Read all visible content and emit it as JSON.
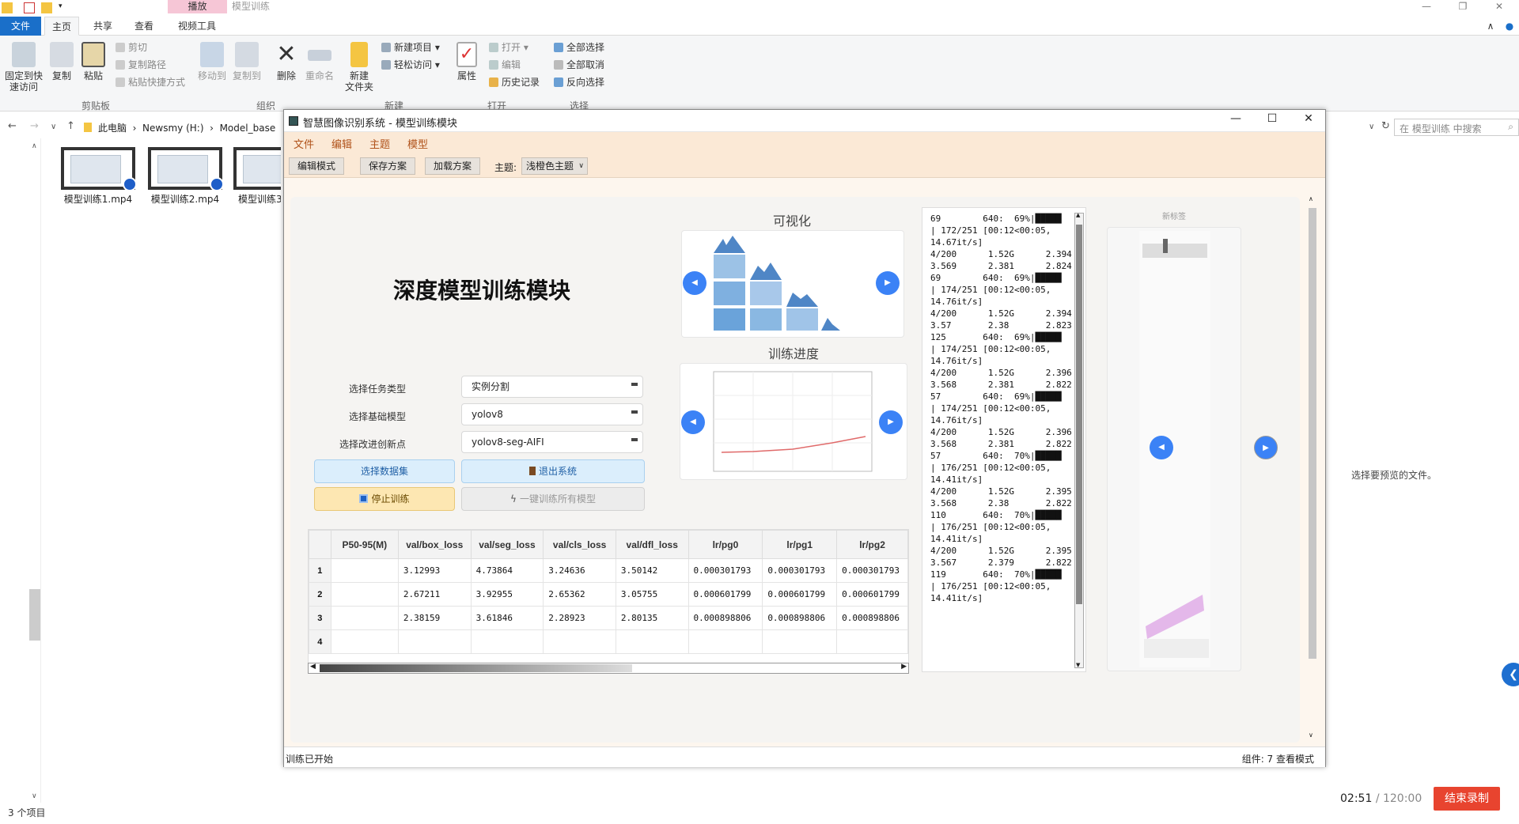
{
  "explorer": {
    "context_tab": "播放",
    "window_title": "模型训练",
    "tabs": [
      "文件",
      "主页",
      "共享",
      "查看",
      "视频工具"
    ],
    "ribbon": {
      "clipboard": {
        "pin": "固定到快\n速访问",
        "copy": "复制",
        "paste": "粘贴",
        "cut": "剪切",
        "copy_path": "复制路径",
        "paste_shortcut": "粘贴快捷方式",
        "group": "剪贴板"
      },
      "organize": {
        "move_to": "移动到",
        "copy_to": "复制到",
        "delete": "删除",
        "rename": "重命名",
        "group": "组织"
      },
      "new": {
        "new_folder": "新建\n文件夹",
        "new_item": "新建项目 ▾",
        "easy_access": "轻松访问 ▾",
        "group": "新建"
      },
      "open": {
        "properties": "属性",
        "open": "打开 ▾",
        "edit": "编辑",
        "history": "历史记录",
        "group": "打开"
      },
      "select": {
        "select_all": "全部选择",
        "select_none": "全部取消",
        "invert": "反向选择",
        "group": "选择"
      }
    },
    "address": {
      "crumbs": "此电脑  ›  Newsmy (H:)  ›  Model_base",
      "search_placeholder": "在 模型训练 中搜索"
    },
    "files": [
      "模型训练1.mp4",
      "模型训练2.mp4",
      "模型训练3."
    ],
    "item_count": "3 个项目",
    "preview_text": "选择要预览的文件。",
    "timer": {
      "elapsed": "02:51",
      "total": "/ 120:00"
    },
    "end_button": "结束录制"
  },
  "app": {
    "title": "智慧图像识别系统 - 模型训练模块",
    "menu": [
      "文件",
      "编辑",
      "主题",
      "模型"
    ],
    "toolbar": {
      "edit_mode": "编辑模式",
      "save_plan": "保存方案",
      "load_plan": "加载方案",
      "theme_label": "主题:",
      "theme_value": "浅橙色主题"
    },
    "headline": "深度模型训练模块",
    "visual_title": "可视化",
    "progress_title": "训练进度",
    "right_panel_title": "新标签",
    "form": {
      "task_label": "选择任务类型",
      "task_value": "实例分割",
      "base_label": "选择基础模型",
      "base_value": "yolov8",
      "improve_label": "选择改进创新点",
      "improve_value": "yolov8-seg-AIFI"
    },
    "buttons": {
      "dataset": "选择数据集",
      "exit": "退出系统",
      "stop": "停止训练",
      "train_all": "一键训练所有模型"
    },
    "table": {
      "columns": [
        "P50-95(M)",
        "val/box_loss",
        "val/seg_loss",
        "val/cls_loss",
        "val/dfl_loss",
        "lr/pg0",
        "lr/pg1",
        "lr/pg2"
      ],
      "rows": [
        {
          "idx": "1",
          "cells": [
            "",
            "3.12993",
            "4.73864",
            "3.24636",
            "3.50142",
            "0.000301793",
            "0.000301793",
            "0.000301793"
          ]
        },
        {
          "idx": "2",
          "cells": [
            "",
            "2.67211",
            "3.92955",
            "2.65362",
            "3.05755",
            "0.000601799",
            "0.000601799",
            "0.000601799"
          ]
        },
        {
          "idx": "3",
          "cells": [
            "",
            "2.38159",
            "3.61846",
            "2.28923",
            "2.80135",
            "0.000898806",
            "0.000898806",
            "0.000898806"
          ]
        },
        {
          "idx": "4",
          "cells": [
            "",
            "",
            "",
            "",
            "",
            "",
            "",
            ""
          ]
        }
      ]
    },
    "log": "69        640:  69%|█████\n| 172/251 [00:12<00:05,\n14.67it/s]\n4/200      1.52G      2.394\n3.569      2.381      2.824\n69        640:  69%|█████\n| 174/251 [00:12<00:05,\n14.76it/s]\n4/200      1.52G      2.394\n3.57       2.38       2.823\n125       640:  69%|█████\n| 174/251 [00:12<00:05,\n14.76it/s]\n4/200      1.52G      2.396\n3.568      2.381      2.822\n57        640:  69%|█████\n| 174/251 [00:12<00:05,\n14.76it/s]\n4/200      1.52G      2.396\n3.568      2.381      2.822\n57        640:  70%|█████\n| 176/251 [00:12<00:05,\n14.41it/s]\n4/200      1.52G      2.395\n3.568      2.38       2.822\n110       640:  70%|█████\n| 176/251 [00:12<00:05,\n14.41it/s]\n4/200      1.52G      2.395\n3.567      2.379      2.822\n119       640:  70%|█████\n| 176/251 [00:12<00:05,\n14.41it/s]",
    "status_left": "训练已开始",
    "status_right": "组件: 7  查看模式"
  }
}
